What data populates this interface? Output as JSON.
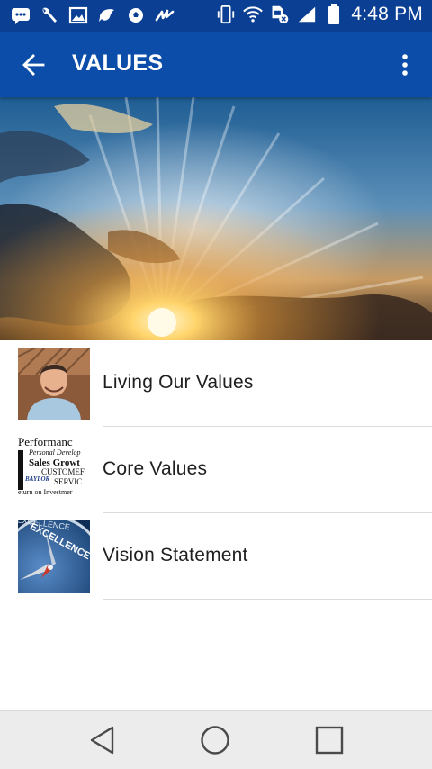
{
  "status_bar": {
    "time": "4:48 PM",
    "left_icons": [
      "message-icon",
      "wrench-icon",
      "image-icon",
      "bird-icon",
      "soccer-icon",
      "signature-icon"
    ],
    "right_icons": [
      "vibrate-icon",
      "wifi-icon",
      "sim-icon",
      "signal-icon",
      "battery-icon"
    ]
  },
  "app_bar": {
    "title": "VALUES",
    "color": "#0b4da8"
  },
  "list": {
    "items": [
      {
        "label": "Living Our Values",
        "thumb": "portrait-thumbnail"
      },
      {
        "label": "Core Values",
        "thumb": "word-cloud-thumbnail"
      },
      {
        "label": "Vision Statement",
        "thumb": "compass-thumbnail"
      }
    ]
  },
  "thumbnails": {
    "word_cloud": {
      "lines": [
        "Performanc",
        "Personal Develop",
        "Sales Growt",
        "CUSTOMEF",
        "BAYLOR",
        "SERVIC",
        "eturn on Investmer"
      ]
    },
    "compass": {
      "text": "EXCELLENCE",
      "text_top": "EXCELLENCE"
    }
  },
  "nav_bar": {
    "icons": [
      "back-triangle-icon",
      "home-circle-icon",
      "recents-square-icon"
    ]
  }
}
